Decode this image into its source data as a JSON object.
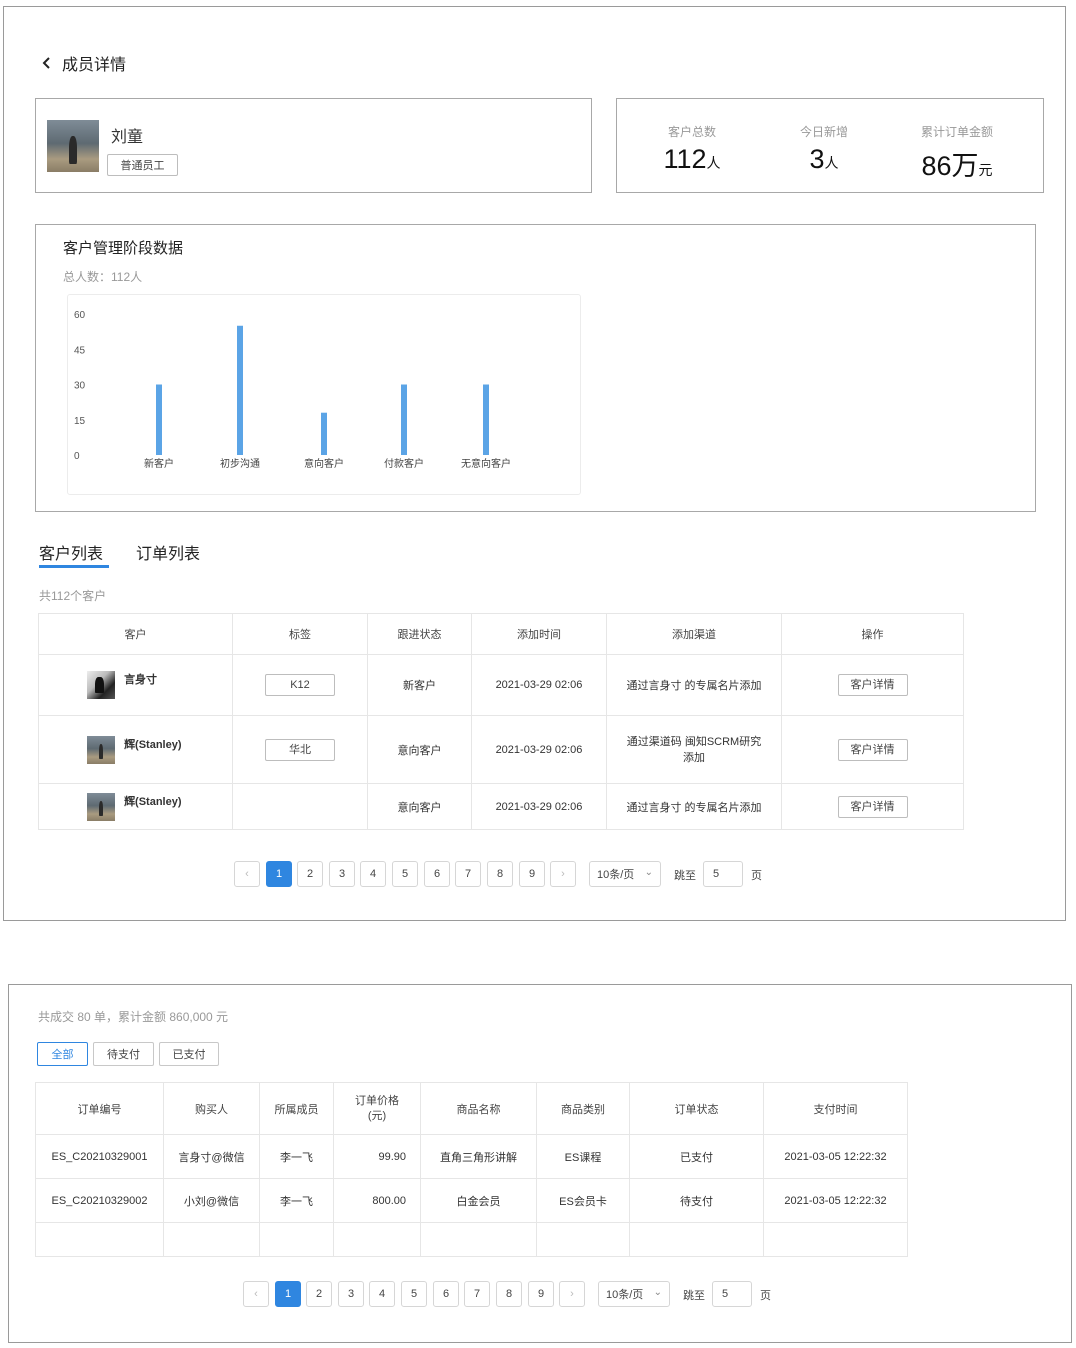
{
  "header": {
    "back_icon": "chevron-left-icon",
    "title": "成员详情"
  },
  "member": {
    "name": "刘童",
    "role": "普通员工",
    "avatar_icon": "user-photo"
  },
  "stats": [
    {
      "label": "客户总数",
      "value": "112",
      "unit": "人"
    },
    {
      "label": "今日新增",
      "value": "3",
      "unit": "人"
    },
    {
      "label": "累计订单金额",
      "value": "86万",
      "unit": "元"
    }
  ],
  "stage": {
    "title": "客户管理阶段数据",
    "total": "总人数：112人"
  },
  "chart_data": {
    "type": "bar",
    "categories": [
      "新客户",
      "初步沟通",
      "意向客户",
      "付款客户",
      "无意向客户"
    ],
    "values": [
      30,
      55,
      18,
      30,
      30
    ],
    "ylim": [
      0,
      60
    ],
    "yticks": [
      "0",
      "15",
      "30",
      "45",
      "60"
    ],
    "color": "#5ba4e6",
    "title": "",
    "xlabel": "",
    "ylabel": ""
  },
  "tabs": [
    {
      "label": "客户列表",
      "active": true
    },
    {
      "label": "订单列表",
      "active": false
    }
  ],
  "customers": {
    "count_text": "共112个客户",
    "columns": [
      "客户",
      "标签",
      "跟进状态",
      "添加时间",
      "添加渠道",
      "操作"
    ],
    "rows": [
      {
        "name": "言身寸",
        "tag": "K12",
        "status": "新客户",
        "time": "2021-03-29 02:06",
        "channel": "通过言身寸 的专属名片添加",
        "action": "客户详情"
      },
      {
        "name": "辉(Stanley)",
        "tag": "华北",
        "status": "意向客户",
        "time": "2021-03-29 02:06",
        "channel": "通过渠道码 闽知SCRM研究 添加",
        "action": "客户详情"
      },
      {
        "name": "辉(Stanley)",
        "tag": "",
        "status": "意向客户",
        "time": "2021-03-29 02:06",
        "channel": "通过言身寸 的专属名片添加",
        "action": "客户详情"
      }
    ]
  },
  "pagination1": {
    "prev": "‹",
    "next": "›",
    "pages": [
      "1",
      "2",
      "3",
      "4",
      "5",
      "6",
      "7",
      "8",
      "9"
    ],
    "current": "1",
    "page_size": "10条/页",
    "jump_label": "跳至",
    "jump_value": "5",
    "page_suffix": "页"
  },
  "orders": {
    "summary": "共成交 80 单，累计金额 860,000 元",
    "filters": [
      {
        "label": "全部",
        "active": true
      },
      {
        "label": "待支付",
        "active": false
      },
      {
        "label": "已支付",
        "active": false
      }
    ],
    "columns": [
      "订单编号",
      "购买人",
      "所属成员",
      "订单价格\n(元)",
      "商品名称",
      "商品类别",
      "订单状态",
      "支付时间"
    ],
    "rows": [
      {
        "id": "ES_C20210329001",
        "buyer": "言身寸@微信",
        "member": "李一飞",
        "price": "99.90",
        "product": "直角三角形讲解",
        "category": "ES课程",
        "status": "已支付",
        "paid": "2021-03-05 12:22:32"
      },
      {
        "id": "ES_C20210329002",
        "buyer": "小刘@微信",
        "member": "李一飞",
        "price": "800.00",
        "product": "白金会员",
        "category": "ES会员卡",
        "status": "待支付",
        "paid": "2021-03-05 12:22:32"
      }
    ]
  },
  "pagination2": {
    "prev": "‹",
    "next": "›",
    "pages": [
      "1",
      "2",
      "3",
      "4",
      "5",
      "6",
      "7",
      "8",
      "9"
    ],
    "current": "1",
    "page_size": "10条/页",
    "jump_label": "跳至",
    "jump_value": "5",
    "page_suffix": "页"
  }
}
